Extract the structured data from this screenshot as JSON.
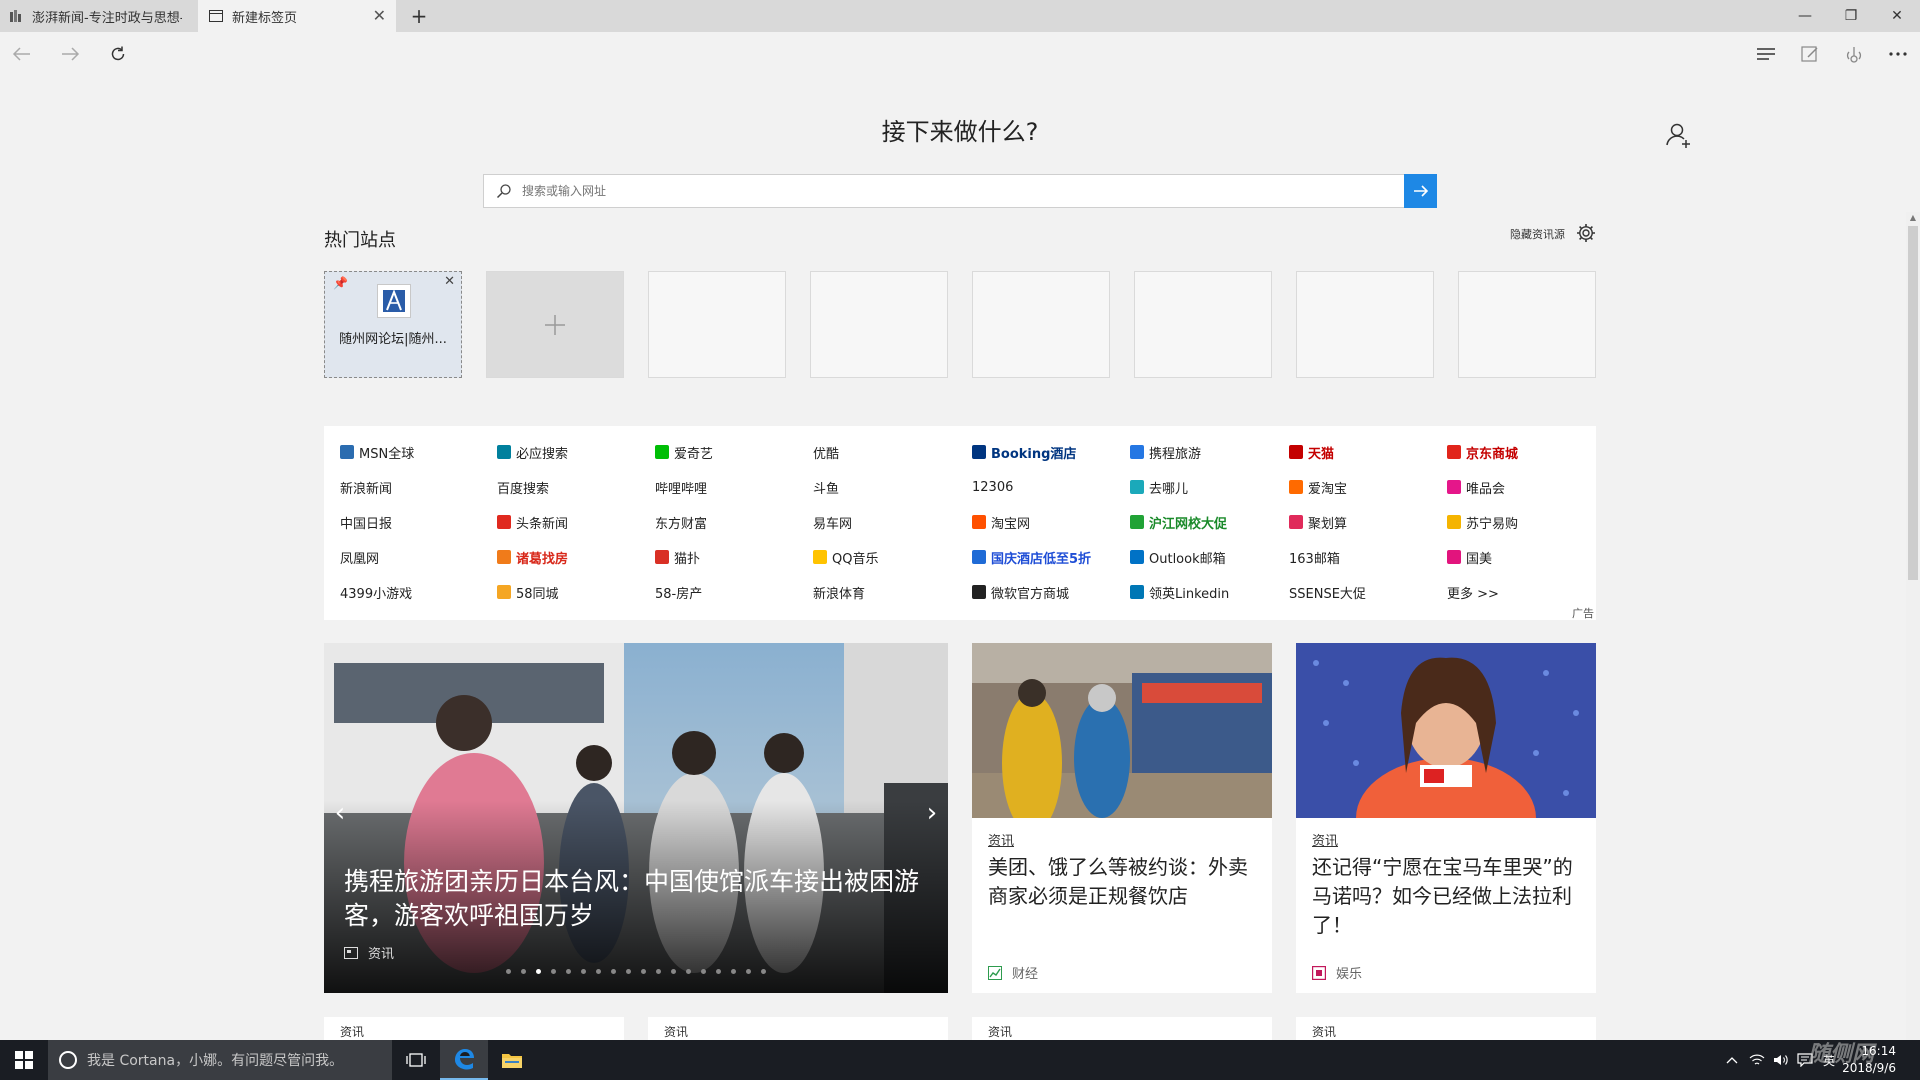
{
  "tabs": [
    {
      "title": "澎湃新闻-专注时政与思想-1",
      "active": false
    },
    {
      "title": "新建标签页",
      "active": true
    }
  ],
  "window": {
    "minimize": "—",
    "maximize": "❐",
    "close": "✕"
  },
  "heading": "接下来做什么?",
  "search": {
    "placeholder": "搜索或输入网址"
  },
  "hot_sites": {
    "title": "热门站点",
    "hide_feed": "隐藏资讯源",
    "tiles": [
      {
        "label": "随州网论坛|随州..."
      }
    ]
  },
  "quick_links": [
    [
      {
        "label": "MSN全球",
        "icon_color": "#2b6cb0"
      },
      {
        "label": "新浪新闻"
      },
      {
        "label": "中国日报"
      },
      {
        "label": "凤凰网"
      },
      {
        "label": "4399小游戏"
      }
    ],
    [
      {
        "label": "必应搜索",
        "icon_color": "#00809d"
      },
      {
        "label": "百度搜索"
      },
      {
        "label": "头条新闻",
        "icon_color": "#e0291f"
      },
      {
        "label": "诸葛找房",
        "icon_color": "#f07b1a",
        "bold": true,
        "color": "#d8281a"
      },
      {
        "label": "58同城",
        "icon_color": "#f5a623"
      }
    ],
    [
      {
        "label": "爱奇艺",
        "icon_color": "#00be06"
      },
      {
        "label": "哔哩哔哩"
      },
      {
        "label": "东方财富"
      },
      {
        "label": "猫扑",
        "icon_color": "#d93025"
      },
      {
        "label": "58-房产"
      }
    ],
    [
      {
        "label": "优酷"
      },
      {
        "label": "斗鱼"
      },
      {
        "label": "易车网"
      },
      {
        "label": "QQ音乐",
        "icon_color": "#ffc300"
      },
      {
        "label": "新浪体育"
      }
    ],
    [
      {
        "label": "Booking酒店",
        "icon_color": "#003580",
        "bold": true,
        "color": "#003580"
      },
      {
        "label": "12306"
      },
      {
        "label": "淘宝网",
        "icon_color": "#ff5000"
      },
      {
        "label": "国庆酒店低至5折",
        "icon_color": "#1f6bd6",
        "bold": true,
        "color": "#1f4ed6"
      },
      {
        "label": "微软官方商城",
        "icon_color": "#222222"
      }
    ],
    [
      {
        "label": "携程旅游",
        "icon_color": "#2577e3"
      },
      {
        "label": "去哪儿",
        "icon_color": "#1ba9ba"
      },
      {
        "label": "沪江网校大促",
        "icon_color": "#21a336",
        "bold": true,
        "color": "#1a8a2a"
      },
      {
        "label": "Outlook邮箱",
        "icon_color": "#0072c6"
      },
      {
        "label": "领英Linkedin",
        "icon_color": "#0077b5"
      }
    ],
    [
      {
        "label": "天猫",
        "icon_color": "#c40000",
        "bold": true,
        "color": "#c40000"
      },
      {
        "label": "爱淘宝",
        "icon_color": "#ff6a00"
      },
      {
        "label": "聚划算",
        "icon_color": "#e02a5a"
      },
      {
        "label": "163邮箱"
      },
      {
        "label": "SSENSE大促"
      }
    ],
    [
      {
        "label": "京东商城",
        "icon_color": "#e1251b",
        "bold": true,
        "color": "#c40000"
      },
      {
        "label": "唯品会",
        "icon_color": "#e5168a"
      },
      {
        "label": "苏宁易购",
        "icon_color": "#f5b400"
      },
      {
        "label": "国美",
        "icon_color": "#e2147d"
      },
      {
        "label": "更多 >>"
      }
    ]
  ],
  "ad_label": "广告",
  "hero": {
    "title": "携程旅游团亲历日本台风：中国使馆派车接出被困游客，游客欢呼祖国万岁",
    "category": "资讯",
    "dots_total": 18,
    "dots_active": 2,
    "prev": "‹",
    "next": "›"
  },
  "news": [
    {
      "category": "资讯",
      "headline": "美团、饿了么等被约谈：外卖商家必须是正规餐饮店",
      "source": "财经",
      "icon_color": "#2e9b4e"
    },
    {
      "category": "资讯",
      "headline": "还记得“宁愿在宝马车里哭”的马诺吗？如今已经做上法拉利了！",
      "source": "娱乐",
      "icon_color": "#c2185b"
    }
  ],
  "peek_cards": [
    "资讯",
    "资讯",
    "资讯",
    "资讯"
  ],
  "taskbar": {
    "cortana": "我是 Cortana，小娜。有问题尽管问我。",
    "ime": "英",
    "time": "16:14",
    "date": "2018/9/6",
    "watermark": "随侧网"
  }
}
